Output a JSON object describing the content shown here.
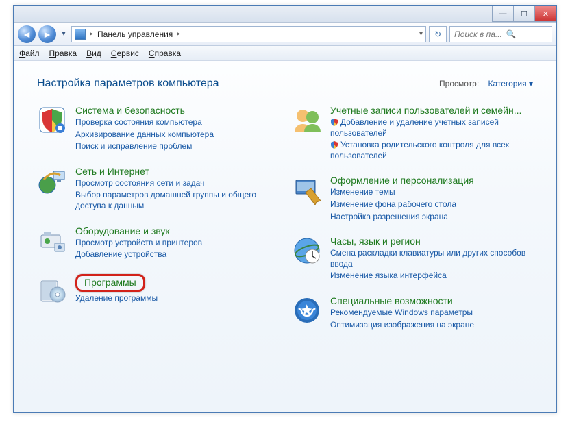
{
  "titlebar": {
    "min": "—",
    "max": "☐",
    "close": "✕"
  },
  "nav": {
    "back": "◄",
    "fwd": "►",
    "drop": "▾",
    "breadcrumb": "Панель управления",
    "sep": "▸",
    "refresh": "↻",
    "search_placeholder": "Поиск в па..."
  },
  "menu": {
    "file": "Файл",
    "edit": "Правка",
    "view": "Вид",
    "tools": "Сервис",
    "help": "Справка"
  },
  "header": {
    "title": "Настройка параметров компьютера",
    "view_label": "Просмотр:",
    "view_value": "Категория ▾"
  },
  "left": [
    {
      "title": "Система и безопасность",
      "links": [
        "Проверка состояния компьютера",
        "Архивирование данных компьютера",
        "Поиск и исправление проблем"
      ]
    },
    {
      "title": "Сеть и Интернет",
      "links": [
        "Просмотр состояния сети и задач",
        "Выбор параметров домашней группы и общего доступа к данным"
      ]
    },
    {
      "title": "Оборудование и звук",
      "links": [
        "Просмотр устройств и принтеров",
        "Добавление устройства"
      ]
    },
    {
      "title": "Программы",
      "highlighted": true,
      "links": [
        "Удаление программы"
      ]
    }
  ],
  "right": [
    {
      "title": "Учетные записи пользователей и семейн...",
      "links": [
        {
          "t": "Добавление и удаление учетных записей пользователей",
          "shield": true
        },
        {
          "t": "Установка родительского контроля для всех пользователей",
          "shield": true
        }
      ]
    },
    {
      "title": "Оформление и персонализация",
      "links": [
        "Изменение темы",
        "Изменение фона рабочего стола",
        "Настройка разрешения экрана"
      ]
    },
    {
      "title": "Часы, язык и регион",
      "links": [
        "Смена раскладки клавиатуры или других способов ввода",
        "Изменение языка интерфейса"
      ]
    },
    {
      "title": "Специальные возможности",
      "links": [
        "Рекомендуемые Windows параметры",
        "Оптимизация изображения на экране"
      ]
    }
  ]
}
